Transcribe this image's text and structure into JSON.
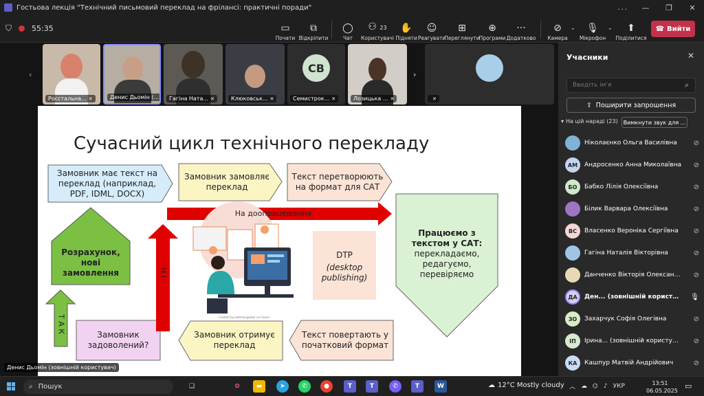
{
  "window": {
    "title": "Гостьова лекція \"Технічний письмовий переклад на фрілансі: практичні поради\"",
    "more": "..."
  },
  "toolbar": {
    "timer": "55:35",
    "items": [
      {
        "label": "Почати",
        "icon": "share-tray-icon"
      },
      {
        "label": "Відкріпити",
        "icon": "unpin-icon"
      },
      {
        "label": "Чат",
        "icon": "chat-icon"
      },
      {
        "label": "Користувачі",
        "icon": "people-icon",
        "count": "23"
      },
      {
        "label": "Підняти",
        "icon": "raise-hand-icon"
      },
      {
        "label": "Реагувати",
        "icon": "react-icon"
      },
      {
        "label": "Переглянути",
        "icon": "view-icon"
      },
      {
        "label": "Програми",
        "icon": "apps-icon"
      },
      {
        "label": "Додатково",
        "icon": "more-icon"
      },
      {
        "label": "Камера",
        "icon": "camera-off-icon"
      },
      {
        "label": "Мікрофон",
        "icon": "mic-off-icon"
      },
      {
        "label": "Поділитися",
        "icon": "share-icon"
      }
    ],
    "leave": "Вийти"
  },
  "tiles": [
    {
      "name": "Росстальна..."
    },
    {
      "name": "Денис Дьомін (..."
    },
    {
      "name": "Гагіна Ната..."
    },
    {
      "name": "Клюковськ..."
    },
    {
      "name": "Семистрок...",
      "initials": "СВ"
    },
    {
      "name": "Лозицька ..."
    },
    {
      "name": ""
    }
  ],
  "slide": {
    "title": "Сучасний цикл технічного перекладу",
    "box1": "Замовник має текст на переклад (наприклад, PDF, IDML, DOCX)",
    "box2": "Замовник замовляє переклад",
    "box3": "Текст перетворюють на формат для САТ",
    "box4_bold": "Працюємо з текстом у САТ:",
    "box4_rest": "перекладаємо, редагуємо, перевіряємо",
    "box5": "Текст повертають у початковий формат",
    "box6": "Замовник отримує переклад",
    "box7": "Замовник задоволений?",
    "box8": "Розрахунок, нові замовлення",
    "rework": "На доопрацювання",
    "no": "Н І",
    "yes": "Т А К",
    "dtp1": "DTP",
    "dtp2": "(desktop publishing)",
    "credit": "Created by katemangostar on Canva"
  },
  "presenter": "Денис Дьомін (зовнішній користувач)",
  "panel": {
    "title": "Учасники",
    "search_placeholder": "Введіть ім'я",
    "invite": "Поширити запрошення",
    "in_meeting": "На цій нараді (23)",
    "mute_all": "Вимкнути звук для ...",
    "participants": [
      {
        "initials": "",
        "name": "Ніколаєнко Ольга Василівна",
        "color": "#7fb3d5"
      },
      {
        "initials": "АМ",
        "name": "Андросенко Анна Миколаївна",
        "color": "#c2d4f0"
      },
      {
        "initials": "БО",
        "name": "Бабко Лілія Олексіївна",
        "color": "#cfe8c9"
      },
      {
        "initials": "",
        "name": "Білик Варвара Олексіївна",
        "color": "#a074c4"
      },
      {
        "initials": "ВС",
        "name": "Власенко Вероніка Сергіївна",
        "color": "#f3d6d6"
      },
      {
        "initials": "",
        "name": "Гагіна Наталія Вікторівна",
        "color": "#9fc4e6"
      },
      {
        "initials": "",
        "name": "Данченко Вікторія Олександ...",
        "color": "#e7d9b5"
      },
      {
        "initials": "ДА",
        "name": "Ден... (зовнішній користувач)",
        "color": "#d7cdee"
      },
      {
        "initials": "ЗО",
        "name": "Захарчук Софія Олегівна",
        "color": "#d8ecc8"
      },
      {
        "initials": "ІП",
        "name": "Ірина... (зовнішній користувач)",
        "color": "#d6ead0"
      },
      {
        "initials": "КА",
        "name": "Кашпур Матвій Андрійович",
        "color": "#c9dcf2"
      }
    ]
  },
  "taskbar": {
    "search": "Пошук",
    "weather": "12°C  Mostly cloudy",
    "lang": "УКР",
    "time": "13:51",
    "date": "06.05.2025"
  }
}
